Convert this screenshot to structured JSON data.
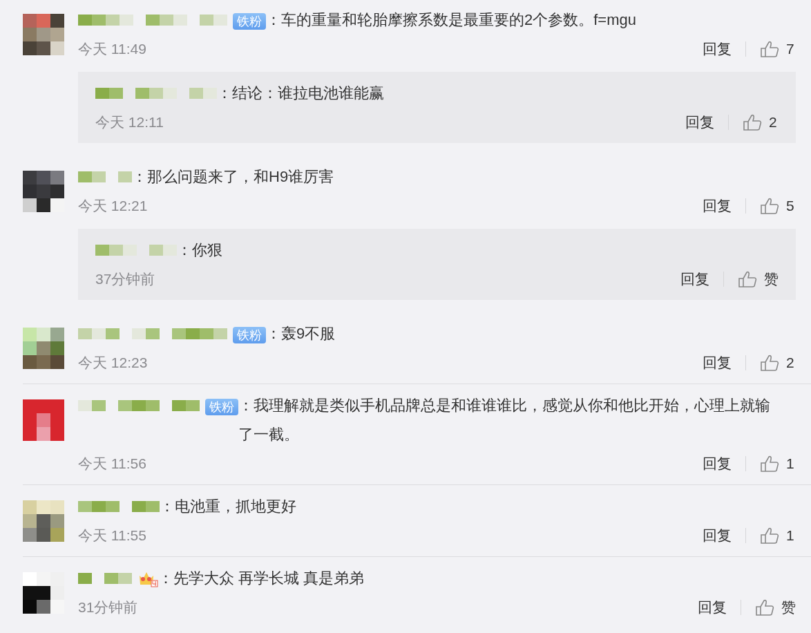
{
  "comments": [
    {
      "username": {
        "kind": "pixelated"
      },
      "badge": {
        "kind": "fan",
        "label": "铁粉"
      },
      "text": "：车的重量和轮胎摩擦系数是最重要的2个参数。f=mgu",
      "time": "今天 11:49",
      "reply_label": "回复",
      "likes": "7",
      "divided": false,
      "replies": [
        {
          "username": {
            "kind": "pixelated"
          },
          "text": "：结论：谁拉电池谁能赢",
          "time": "今天 12:11",
          "reply_label": "回复",
          "likes": "2"
        }
      ]
    },
    {
      "username": {
        "kind": "pixelated"
      },
      "text": "：那么问题来了，和H9谁厉害",
      "time": "今天 12:21",
      "reply_label": "回复",
      "likes": "5",
      "divided": false,
      "replies": [
        {
          "username": {
            "kind": "pixelated"
          },
          "text": "：你狠",
          "time": "37分钟前",
          "reply_label": "回复",
          "likes": "赞"
        }
      ]
    },
    {
      "username": {
        "kind": "pixelated"
      },
      "badge": {
        "kind": "fan",
        "label": "铁粉"
      },
      "text": "：轰9不服",
      "time": "今天 12:23",
      "reply_label": "回复",
      "likes": "2",
      "divided": false
    },
    {
      "username": {
        "kind": "pixelated"
      },
      "badge": {
        "kind": "fan",
        "label": "铁粉"
      },
      "text": "：我理解就是类似手机品牌总是和谁谁谁比，感觉从你和他比开始，心理上就输了一截。",
      "time": "今天 11:56",
      "reply_label": "回复",
      "likes": "1",
      "divided": true
    },
    {
      "username": {
        "kind": "pixelated"
      },
      "text": "：电池重，抓地更好",
      "time": "今天 11:55",
      "reply_label": "回复",
      "likes": "1",
      "divided": true
    },
    {
      "username": {
        "kind": "pixelated"
      },
      "badge": {
        "kind": "crown"
      },
      "text": "：先学大众 再学长城 真是弟弟",
      "time": "31分钟前",
      "reply_label": "回复",
      "likes": "赞",
      "divided": true
    }
  ]
}
